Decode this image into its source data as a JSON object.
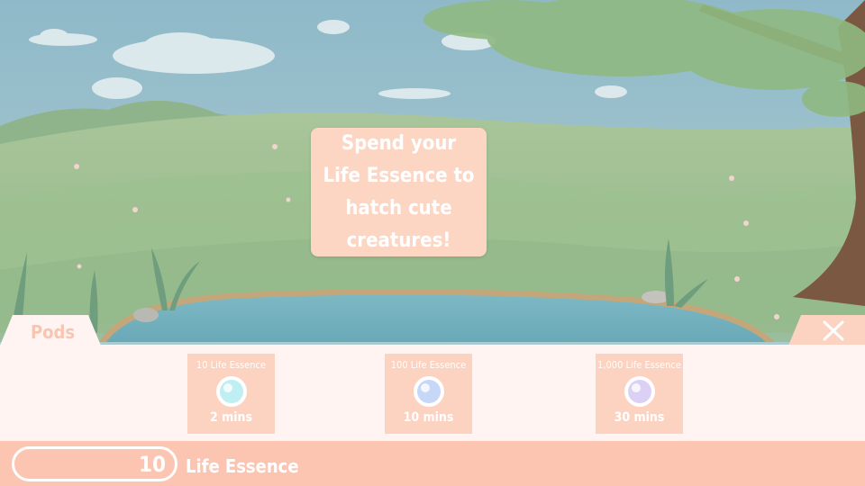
{
  "tooltip": {
    "text": "Spend your Life Essence to hatch cute creatures!"
  },
  "panel": {
    "tab_label": "Pods",
    "close_icon": "close-icon",
    "pods": [
      {
        "cost": "10 Life Essence",
        "time": "2 mins",
        "orb_color": "#bfeff2"
      },
      {
        "cost": "100 Life Essence",
        "time": "10 mins",
        "orb_color": "#c7d7f7"
      },
      {
        "cost": "1,000 Life Essence",
        "time": "30 mins",
        "orb_color": "#dcd0f5"
      }
    ]
  },
  "status": {
    "value": "10",
    "label": "Life Essence"
  },
  "colors": {
    "accent": "#fcc5b1",
    "panel": "#fff4f1",
    "card": "#fcd2c1"
  }
}
